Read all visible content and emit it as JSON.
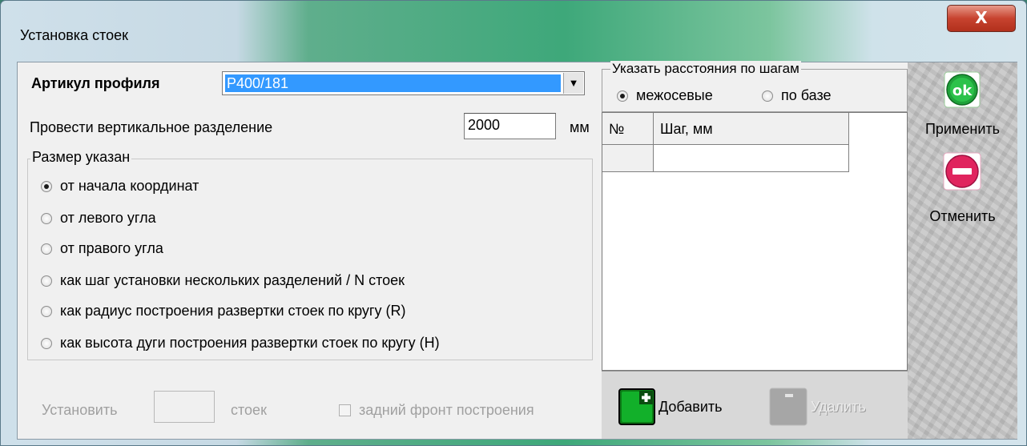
{
  "window": {
    "title": "Установка стоек",
    "close_glyph": "X"
  },
  "profile": {
    "label": "Артикул профиля",
    "value": "P400/181",
    "dropdown_glyph": "▼"
  },
  "vertical_split": {
    "label": "Провести вертикальное разделение",
    "value": "2000",
    "unit": "мм"
  },
  "size_group": {
    "title": "Размер указан",
    "options": [
      {
        "label": "от начала координат",
        "checked": true
      },
      {
        "label": "от левого угла",
        "checked": false
      },
      {
        "label": "от правого угла",
        "checked": false
      },
      {
        "label": "как шаг установки нескольких разделений / N стоек",
        "checked": false
      },
      {
        "label": "как радиус построения развертки стоек по кругу (R)",
        "checked": false
      },
      {
        "label": "как высота дуги построения развертки стоек по кругу (H)",
        "checked": false
      }
    ]
  },
  "install": {
    "label": "Установить",
    "value": "",
    "unit": "стоек",
    "back_front_label": "задний фронт построения"
  },
  "step_group": {
    "title": "Указать расстояния по шагам",
    "options": [
      {
        "label": "межосевые",
        "checked": true
      },
      {
        "label": "по базе",
        "checked": false
      }
    ]
  },
  "grid": {
    "columns": [
      "№",
      "Шаг, мм"
    ],
    "rows": [
      [
        "",
        ""
      ]
    ]
  },
  "actions": {
    "add_label": "Добавить",
    "delete_label": "Удалить",
    "apply_label": "Применить",
    "cancel_label": "Отменить",
    "ok_icon_text": "ok"
  },
  "colors": {
    "selection": "#3399ff",
    "ok_green": "#1fa33a",
    "cancel_red": "#e0245e",
    "add_green": "#11a21f"
  },
  "icons": [
    "close-icon",
    "dropdown-arrow-icon",
    "ok-icon",
    "cancel-icon",
    "add-icon",
    "delete-icon"
  ]
}
